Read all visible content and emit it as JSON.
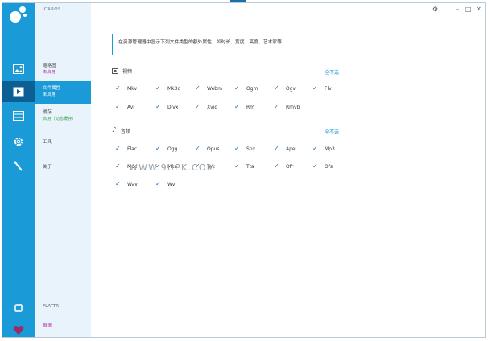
{
  "app": {
    "title": "ICAROS"
  },
  "window_controls": [
    "gear",
    "minimize",
    "maximize",
    "close"
  ],
  "menu": {
    "items": [
      {
        "label": "缩略图",
        "status": "未启用"
      },
      {
        "label": "文件属性",
        "status": "未启用"
      },
      {
        "label": "缓存",
        "status": "启用（动态缓存）"
      },
      {
        "label": "工具",
        "status": ""
      },
      {
        "label": "关于",
        "status": ""
      }
    ],
    "footer": [
      {
        "label": "FLATTR"
      },
      {
        "label": "捐赠"
      }
    ]
  },
  "main": {
    "description": "在资源管理器中显示下列文件类型的额外属性，如时长、宽度、高度、艺术家等",
    "sections": [
      {
        "title": "视频",
        "icon": "film-icon",
        "clear_label": "全不选",
        "items": [
          "Mkv",
          "Mk3d",
          "Webm",
          "Ogm",
          "Ogv",
          "Flv",
          "Avi",
          "Divx",
          "Xvid",
          "Rm",
          "Rmvb"
        ]
      },
      {
        "title": "音频",
        "icon": "music-note-icon",
        "clear_label": "全不选",
        "items": [
          "Flac",
          "Ogg",
          "Opus",
          "Spx",
          "Ape",
          "Mp3",
          "Mpc",
          "Mka",
          "Tak",
          "Tta",
          "Ofr",
          "Ofs",
          "Wav",
          "Wv"
        ]
      }
    ]
  },
  "watermark": "WWW.9UPK.COM",
  "colors": {
    "accent": "#1a9ad6",
    "active_nav": "#0b5f92",
    "menu_bg": "#e8f3fb",
    "status_purple": "#b02aa0",
    "status_green": "#3ba24a"
  }
}
